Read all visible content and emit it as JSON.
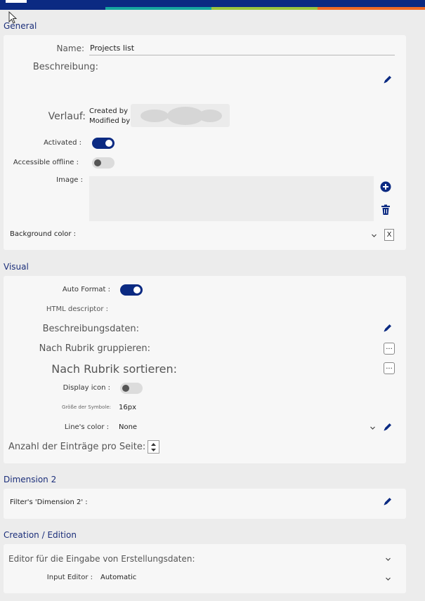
{
  "colors": {
    "brand": "#0b2a82",
    "teal": "#16a7a0",
    "green": "#9bc53d",
    "orange": "#ef6b25"
  },
  "general": {
    "title": "General",
    "name_label": "Name:",
    "name_value": "Projects list",
    "description_label": "Beschreibung:",
    "history_label": "Verlauf:",
    "created_by": "Created by",
    "modified_by": "Modified by",
    "activated_label": "Activated :",
    "activated": true,
    "offline_label": "Accessible offline :",
    "offline": false,
    "image_label": "Image :",
    "bg_label": "Background color :",
    "clear_label": "X"
  },
  "visual": {
    "title": "Visual",
    "auto_format_label": "Auto Format :",
    "auto_format": true,
    "html_descriptor_label": "HTML descriptor :",
    "description_data_label": "Beschreibungsdaten:",
    "group_label": "Nach Rubrik gruppieren:",
    "sort_label": "Nach Rubrik sortieren:",
    "display_icon_label": "Display icon :",
    "display_icon": false,
    "icon_size_label": "Größe der Symbole:",
    "icon_size_value": "16px",
    "line_color_label": "Line's color :",
    "line_color_value": "None",
    "per_page_label": "Anzahl der Einträge pro Seite:",
    "dots_label": "..."
  },
  "dimension2": {
    "title": "Dimension 2",
    "filter_label": "Filter's 'Dimension 2' :"
  },
  "creation": {
    "title": "Creation / Edition",
    "editor_label": "Editor für die Eingabe von Erstellungsdaten:",
    "input_editor_label": "Input Editor :",
    "input_editor_value": "Automatic"
  }
}
